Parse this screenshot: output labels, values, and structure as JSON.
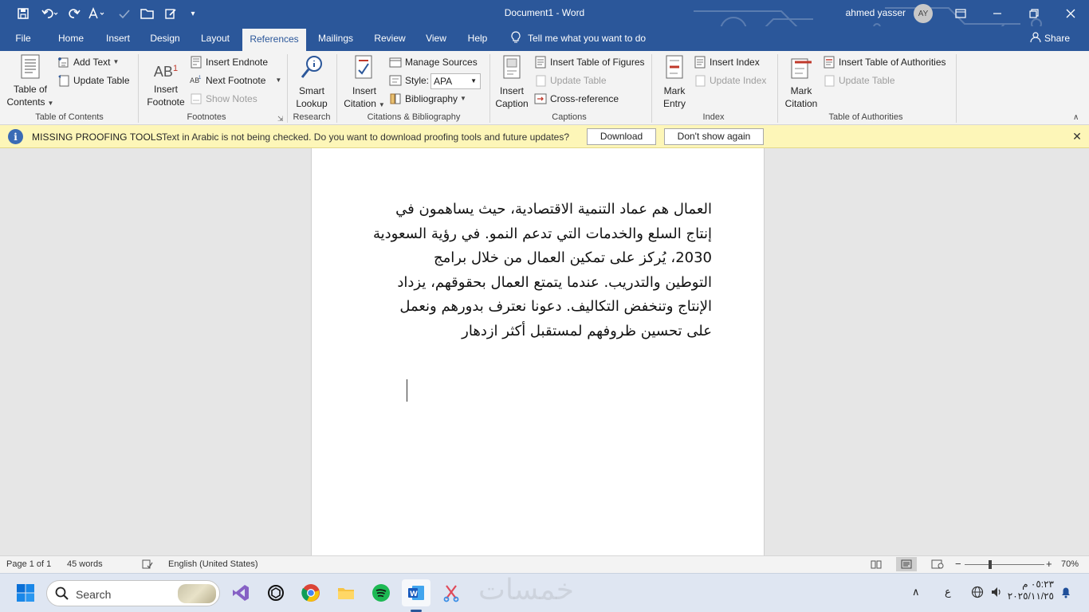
{
  "titlebar": {
    "title": "Document1  -  Word",
    "user_name": "ahmed yasser",
    "user_initials": "AY"
  },
  "tabs": [
    {
      "label": "File"
    },
    {
      "label": "Home"
    },
    {
      "label": "Insert"
    },
    {
      "label": "Design"
    },
    {
      "label": "Layout"
    },
    {
      "label": "References"
    },
    {
      "label": "Mailings"
    },
    {
      "label": "Review"
    },
    {
      "label": "View"
    },
    {
      "label": "Help"
    }
  ],
  "active_tab": "References",
  "tell_me": "Tell me what you want to do",
  "share": "Share",
  "ribbon": {
    "toc": {
      "table_of_contents": "Table of",
      "table_of_contents_2": "Contents",
      "add_text": "Add Text",
      "update_table": "Update Table",
      "group": "Table of Contents"
    },
    "footnotes": {
      "insert_footnote": "Insert",
      "insert_footnote_2": "Footnote",
      "insert_endnote": "Insert Endnote",
      "next_footnote": "Next Footnote",
      "show_notes": "Show Notes",
      "group": "Footnotes",
      "ab_glyph": "AB",
      "ab_sup": "1"
    },
    "research": {
      "smart_lookup": "Smart",
      "smart_lookup_2": "Lookup",
      "group": "Research"
    },
    "citations": {
      "insert_citation": "Insert",
      "insert_citation_2": "Citation",
      "manage_sources": "Manage Sources",
      "style_label": "Style:",
      "style_value": "APA",
      "bibliography": "Bibliography",
      "group": "Citations & Bibliography"
    },
    "captions": {
      "insert_caption": "Insert",
      "insert_caption_2": "Caption",
      "insert_table_of_figures": "Insert Table of Figures",
      "update_table": "Update Table",
      "cross_reference": "Cross-reference",
      "group": "Captions"
    },
    "index": {
      "mark_entry": "Mark",
      "mark_entry_2": "Entry",
      "insert_index": "Insert Index",
      "update_index": "Update Index",
      "group": "Index"
    },
    "authorities": {
      "mark_citation": "Mark",
      "mark_citation_2": "Citation",
      "insert_table_of_authorities": "Insert Table of Authorities",
      "update_table": "Update Table",
      "group": "Table of Authorities"
    }
  },
  "infobar": {
    "title": "MISSING PROOFING TOOLS",
    "message": "Text in Arabic is not being checked. Do you want to download proofing tools and future updates?",
    "download": "Download",
    "dont_show": "Don't show again"
  },
  "document": {
    "lines": [
      "العمال هم عماد التنمية الاقتصادية، حيث يساهمون في",
      "إنتاج السلع والخدمات التي تدعم النمو. في رؤية السعودية",
      "2030، يُركز على تمكين العمال من خلال برامج",
      "التوطين والتدريب. عندما يتمتع العمال بحقوقهم، يزداد",
      "الإنتاج وتنخفض التكاليف. دعونا نعترف بدورهم ونعمل",
      "على تحسين ظروفهم لمستقبل أكثر ازدهار"
    ]
  },
  "statusbar": {
    "page": "Page 1 of 1",
    "words": "45 words",
    "language": "English (United States)",
    "zoom": "70%"
  },
  "taskbar": {
    "search": "Search",
    "watermark": "خمسات",
    "time": "٠٥:٢٣ م",
    "date": "٢٠٢٥/١١/٢٥",
    "input_lang": "ع"
  },
  "colors": {
    "accent": "#2b579a",
    "infobar": "#fdf6b8"
  }
}
